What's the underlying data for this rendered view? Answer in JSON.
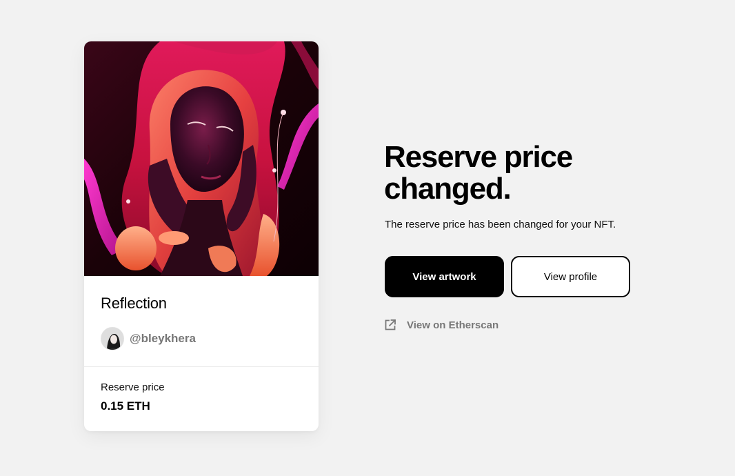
{
  "card": {
    "title": "Reflection",
    "creator_handle": "@bleykhera",
    "price_label": "Reserve price",
    "price_value": "0.15 ETH"
  },
  "main": {
    "heading_line1": "Reserve price",
    "heading_line2": "changed.",
    "description": "The reserve price has been changed for your NFT.",
    "primary_button_label": "View artwork",
    "secondary_button_label": "View profile",
    "etherscan_link_label": "View on Etherscan"
  },
  "icons": {
    "etherscan": "external-link-icon"
  },
  "colors": {
    "background": "#f2f2f2",
    "primary_button": "#000000",
    "link_gray": "#777777",
    "art_accent_pink": "#e0116e",
    "art_accent_magenta": "#ff2cc0"
  }
}
